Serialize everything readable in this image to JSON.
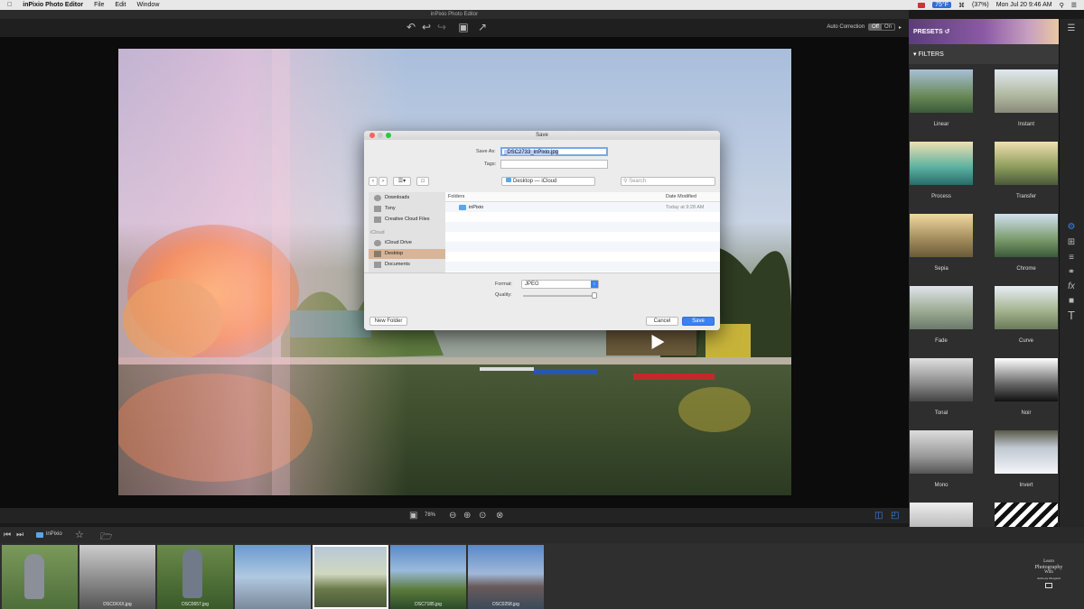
{
  "menubar": {
    "apple": "",
    "app_name": "inPixio Photo Editor",
    "items": [
      "File",
      "Edit",
      "Window"
    ],
    "temp": "75°F",
    "battery": "(37%)",
    "clock": "Mon Jul 20  9:46 AM"
  },
  "window": {
    "title": "inPixio Photo Editor"
  },
  "toolbar": {
    "auto_correction_label": "Auto Correction",
    "toggle_off": "Off",
    "toggle_on": "On"
  },
  "zoom": {
    "value": "78%"
  },
  "filmstrip": {
    "folder": "inPixio",
    "thumbs": [
      {
        "caption": ""
      },
      {
        "caption": "DSC0XXX.jpg"
      },
      {
        "caption": "DSC0657.jpg"
      },
      {
        "caption": ""
      },
      {
        "caption": ""
      },
      {
        "caption": "DSC7185.jpg"
      },
      {
        "caption": "DSC0258.jpg"
      }
    ]
  },
  "panel": {
    "presets_label": "PRESETS",
    "filters_label": "FILTERS",
    "filters": [
      {
        "name": "Linear"
      },
      {
        "name": "Instant"
      },
      {
        "name": "Process"
      },
      {
        "name": "Transfer"
      },
      {
        "name": "Sepia"
      },
      {
        "name": "Chrome"
      },
      {
        "name": "Fade"
      },
      {
        "name": "Curve"
      },
      {
        "name": "Tonal"
      },
      {
        "name": "Noir"
      },
      {
        "name": "Mono"
      },
      {
        "name": "Invert"
      }
    ]
  },
  "watermark": {
    "line1": "Learn",
    "line2": "Photography",
    "line3": "With",
    "line4": "Anthony Morganti"
  },
  "dialog": {
    "title": "Save",
    "save_as_label": "Save As:",
    "save_as_value": "_DSC2733_inPixio.jpg",
    "tags_label": "Tags:",
    "location": "Desktop — iCloud",
    "search_placeholder": "Search",
    "sidebar": {
      "favorites": [
        {
          "label": "Downloads"
        },
        {
          "label": "Tony"
        },
        {
          "label": "Creative Cloud Files"
        }
      ],
      "icloud_header": "iCloud",
      "icloud": [
        {
          "label": "iCloud Drive"
        },
        {
          "label": "Desktop"
        },
        {
          "label": "Documents"
        }
      ]
    },
    "columns": {
      "folders": "Folders",
      "date": "Date Modified"
    },
    "files": [
      {
        "name": "inPixio",
        "date": "Today at 9:28 AM"
      }
    ],
    "format_label": "Format:",
    "format_value": "JPEG",
    "quality_label": "Quality:",
    "new_folder": "New Folder",
    "cancel": "Cancel",
    "save": "Save"
  },
  "colors": {
    "accent": "#2d6fd6",
    "save_button": "#3b82f0",
    "selected_sidebar": "#d8b596"
  }
}
